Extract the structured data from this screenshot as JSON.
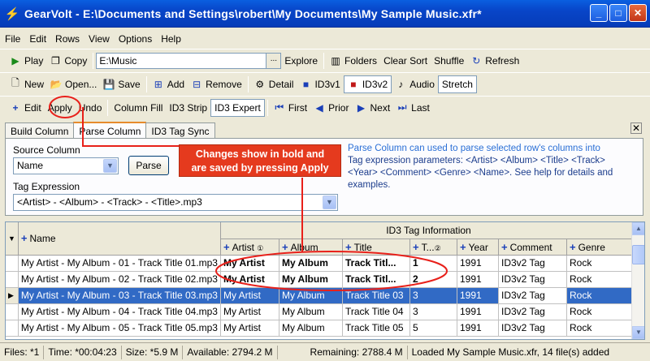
{
  "window": {
    "title": "GearVolt - E:\\Documents and Settings\\robert\\My Documents\\My Sample Music.xfr*",
    "minimize": "_",
    "maximize": "□",
    "close": "✕"
  },
  "menu": [
    "File",
    "Edit",
    "Rows",
    "View",
    "Options",
    "Help"
  ],
  "toolbar1": {
    "play": "Play",
    "copy": "Copy",
    "path": "E:\\Music",
    "path_btn": "...",
    "explore": "Explore",
    "folders": "Folders",
    "clear_sort": "Clear Sort",
    "shuffle": "Shuffle",
    "refresh": "Refresh"
  },
  "toolbar2": {
    "new": "New",
    "open": "Open...",
    "save": "Save",
    "add": "Add",
    "remove": "Remove",
    "detail": "Detail",
    "id3v1": "ID3v1",
    "id3v2": "ID3v2",
    "audio": "Audio",
    "stretch": "Stretch"
  },
  "toolbar3": {
    "edit": "Edit",
    "apply": "Apply",
    "undo": "Undo",
    "column_fill": "Column Fill",
    "id3_strip": "ID3 Strip",
    "id3_expert": "ID3 Expert",
    "first": "First",
    "prior": "Prior",
    "next": "Next",
    "last": "Last"
  },
  "tabs": [
    "Build Column",
    "Parse Column",
    "ID3 Tag Sync"
  ],
  "parse": {
    "source_label": "Source Column",
    "source_value": "Name",
    "parse_btn": "Parse",
    "tag_label": "Tag Expression",
    "tag_value": "<Artist> - <Album> - <Track> - <Title>.mp3",
    "help_first": "Parse Column can used to parse selected row's columns into",
    "help_rest": "Tag expression parameters: <Artist> <Album> <Title> <Track> <Year> <Comment> <Genre> <Name>.  See help for details and examples."
  },
  "callout": {
    "line1": "Changes show in bold and",
    "line2": "are saved by pressing Apply"
  },
  "grid": {
    "group_header": "ID3 Tag Information",
    "columns": {
      "name": "Name",
      "artist": "Artist",
      "album": "Album",
      "title": "Title",
      "track": "T...",
      "year": "Year",
      "comment": "Comment",
      "genre": "Genre"
    },
    "rows": [
      {
        "name": "My Artist - My Album - 01 - Track Title 01.mp3",
        "artist": "My Artist",
        "album": "My Album",
        "title": "Track Titl...",
        "track": "1",
        "year": "1991",
        "comment": "ID3v2 Tag",
        "genre": "Rock",
        "bold": true,
        "selected": false
      },
      {
        "name": "My Artist - My Album - 02 - Track Title 02.mp3",
        "artist": "My Artist",
        "album": "My Album",
        "title": "Track Titl...",
        "track": "2",
        "year": "1991",
        "comment": "ID3v2 Tag",
        "genre": "Rock",
        "bold": true,
        "selected": false
      },
      {
        "name": "My Artist - My Album - 03 - Track Title 03.mp3",
        "artist": "My Artist",
        "album": "My Album",
        "title": "Track Title 03",
        "track": "3",
        "year": "1991",
        "comment": "ID3v2 Tag",
        "genre": "Rock",
        "bold": false,
        "selected": true
      },
      {
        "name": "My Artist - My Album - 04 - Track Title 04.mp3",
        "artist": "My Artist",
        "album": "My Album",
        "title": "Track Title 04",
        "track": "3",
        "year": "1991",
        "comment": "ID3v2 Tag",
        "genre": "Rock",
        "bold": false,
        "selected": false
      },
      {
        "name": "My Artist - My Album - 05 - Track Title 05.mp3",
        "artist": "My Artist",
        "album": "My Album",
        "title": "Track Title 05",
        "track": "5",
        "year": "1991",
        "comment": "ID3v2 Tag",
        "genre": "Rock",
        "bold": false,
        "selected": false
      }
    ]
  },
  "status": {
    "files": "Files: *1",
    "time": "Time: *00:04:23",
    "size": "Size: *5.9 M",
    "available": "Available: 2794.2 M",
    "remaining": "Remaining: 2788.4 M",
    "message": "Loaded My Sample Music.xfr, 14 file(s) added"
  }
}
